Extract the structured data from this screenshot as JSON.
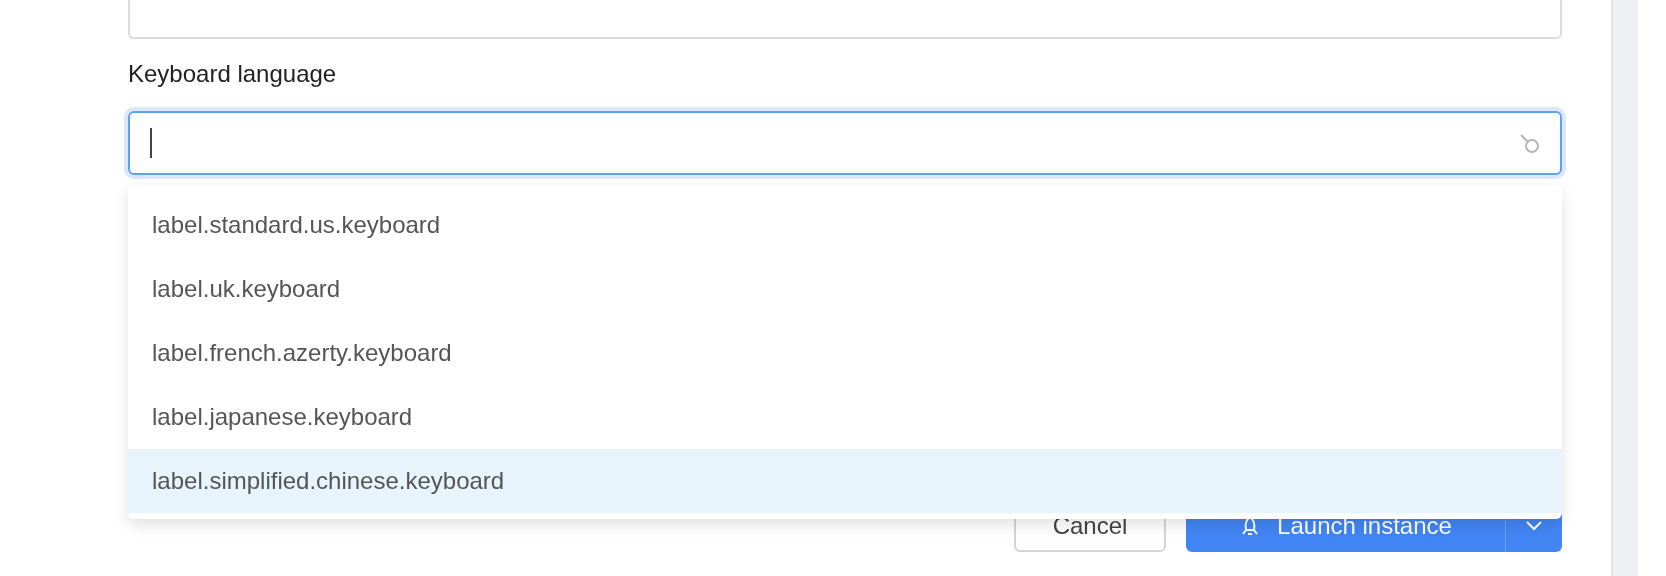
{
  "keyboard_language": {
    "label": "Keyboard language",
    "options": [
      {
        "label": "label.standard.us.keyboard",
        "selected": false
      },
      {
        "label": "label.uk.keyboard",
        "selected": false
      },
      {
        "label": "label.french.azerty.keyboard",
        "selected": false
      },
      {
        "label": "label.japanese.keyboard",
        "selected": false
      },
      {
        "label": "label.simplified.chinese.keyboard",
        "selected": true
      }
    ]
  },
  "buttons": [
    {
      "kind": "secondary",
      "label": "Cancel"
    },
    {
      "kind": "primary",
      "label": "Launch instance"
    }
  ]
}
